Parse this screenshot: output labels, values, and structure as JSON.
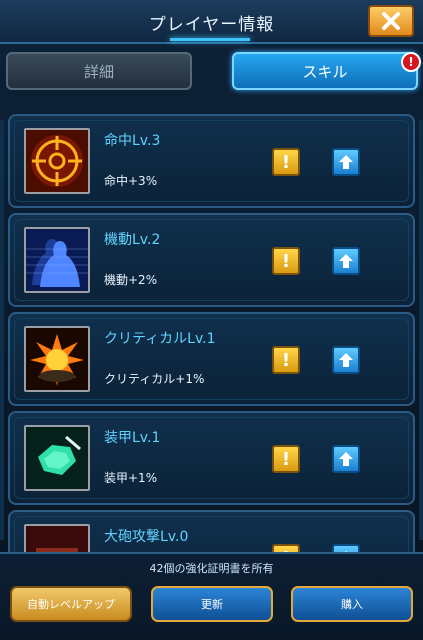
{
  "header": {
    "title": "プレイヤー情報",
    "close_icon": "close-icon"
  },
  "tabs": [
    {
      "label": "詳細",
      "active": false
    },
    {
      "label": "スキル",
      "active": true,
      "badge": "!"
    }
  ],
  "skills": [
    {
      "name": "命中Lv.3",
      "effect": "命中+3%",
      "icon": "crosshair-icon"
    },
    {
      "name": "機動Lv.2",
      "effect": "機動+2%",
      "icon": "mobility-silhouette-icon"
    },
    {
      "name": "クリティカルLv.1",
      "effect": "クリティカル+1%",
      "icon": "explosion-icon"
    },
    {
      "name": "装甲Lv.1",
      "effect": "装甲+1%",
      "icon": "armor-icon"
    },
    {
      "name": "大砲攻撃Lv.0",
      "effect": "",
      "icon": "cannon-icon"
    }
  ],
  "footer": {
    "certificate_text": "42個の強化証明書を所有",
    "auto_levelup_label": "自動レベルアップ",
    "refresh_label": "更新",
    "buy_label": "購入"
  },
  "colors": {
    "accent_blue": "#27a7f0",
    "warning_yellow": "#ffd64a",
    "skill_name_cyan": "#5fd3ff",
    "alert_red": "#d8141f"
  }
}
